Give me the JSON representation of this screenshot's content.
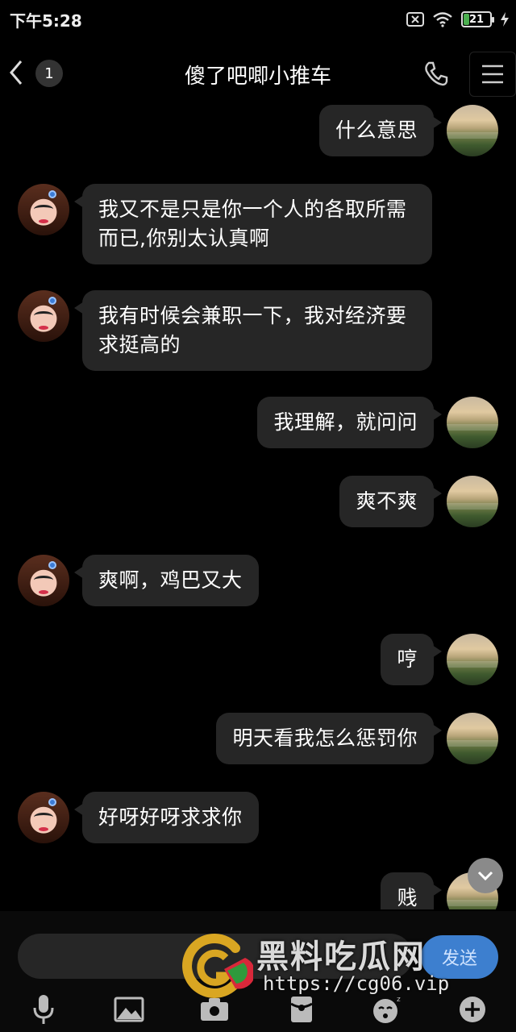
{
  "status_bar": {
    "time": "下午5:28",
    "battery_level": "21",
    "battery_fraction": 0.21
  },
  "header": {
    "back_icon": "chevron-left-icon",
    "unread_count": "1",
    "title": "傻了吧唧小推车",
    "call_icon": "phone-icon",
    "menu_icon": "hamburger-menu-icon"
  },
  "messages": [
    {
      "sender": "me",
      "text": "什么意思"
    },
    {
      "sender": "them",
      "text": "我又不是只是你一个人的各取所需而已,你别太认真啊"
    },
    {
      "sender": "them",
      "text": "我有时候会兼职一下，我对经济要求挺高的"
    },
    {
      "sender": "me",
      "text": "我理解，就问问"
    },
    {
      "sender": "me",
      "text": "爽不爽"
    },
    {
      "sender": "them",
      "text": "爽啊，鸡巴又大"
    },
    {
      "sender": "me",
      "text": "哼"
    },
    {
      "sender": "me",
      "text": "明天看我怎么惩罚你"
    },
    {
      "sender": "them",
      "text": "好呀好呀求求你"
    },
    {
      "sender": "me",
      "text": "贱"
    }
  ],
  "input": {
    "value": "",
    "send_label": "发送"
  },
  "toolbar": [
    "microphone-icon",
    "image-icon",
    "camera-icon",
    "red-packet-icon",
    "emoji-icon",
    "plus-icon"
  ],
  "watermark": {
    "text": "黑料吃瓜网",
    "url": "https://cg06.vip"
  },
  "colors": {
    "background": "#000000",
    "bubble": "#262626",
    "send_button": "#3d7fcf"
  }
}
